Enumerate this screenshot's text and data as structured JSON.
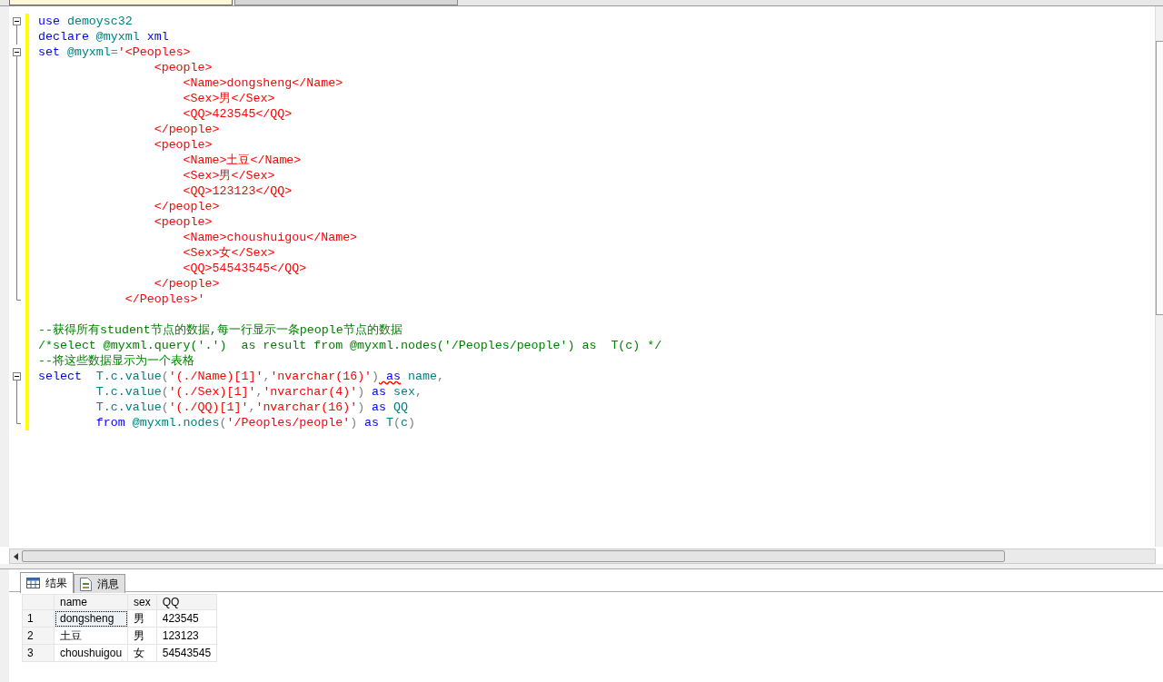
{
  "editor_tabs": [
    {
      "selected": true
    },
    {
      "selected": false
    }
  ],
  "code_lines": [
    {
      "kind": "start",
      "tokens": [
        {
          "kind": "keyword",
          "text": "use"
        },
        {
          "kind": "ident",
          "text": " demoysc32"
        }
      ]
    },
    {
      "kind": "inner",
      "tokens": [
        {
          "kind": "keyword",
          "text": "declare"
        },
        {
          "kind": "ident",
          "text": " @myxml"
        },
        {
          "kind": "keyword",
          "text": " xml"
        }
      ]
    },
    {
      "kind": "start",
      "tokens": [
        {
          "kind": "keyword",
          "text": "set"
        },
        {
          "kind": "ident",
          "text": " @myxml"
        },
        {
          "kind": "punct",
          "text": "="
        },
        {
          "kind": "string",
          "text": "'<Peoples>"
        }
      ]
    },
    {
      "kind": "inner",
      "tokens": [
        {
          "kind": "string",
          "text": "                <people>"
        }
      ]
    },
    {
      "kind": "inner",
      "tokens": [
        {
          "kind": "string",
          "text": "                    <Name>dongsheng</Name>"
        }
      ]
    },
    {
      "kind": "inner",
      "tokens": [
        {
          "kind": "string",
          "text": "                    <Sex>男</Sex>"
        }
      ]
    },
    {
      "kind": "inner",
      "tokens": [
        {
          "kind": "string",
          "text": "                    <QQ>423545</QQ>"
        }
      ]
    },
    {
      "kind": "inner",
      "tokens": [
        {
          "kind": "string",
          "text": "                </people>"
        }
      ]
    },
    {
      "kind": "inner",
      "tokens": [
        {
          "kind": "string",
          "text": "                <people>"
        }
      ]
    },
    {
      "kind": "inner",
      "tokens": [
        {
          "kind": "string",
          "text": "                    <Name>土豆</Name>"
        }
      ]
    },
    {
      "kind": "inner",
      "tokens": [
        {
          "kind": "string",
          "text": "                    <Sex>男</Sex>"
        }
      ]
    },
    {
      "kind": "inner",
      "tokens": [
        {
          "kind": "string",
          "text": "                    <QQ>123123</QQ>"
        }
      ]
    },
    {
      "kind": "inner",
      "tokens": [
        {
          "kind": "string",
          "text": "                </people>"
        }
      ]
    },
    {
      "kind": "inner",
      "tokens": [
        {
          "kind": "string",
          "text": "                <people>"
        }
      ]
    },
    {
      "kind": "inner",
      "tokens": [
        {
          "kind": "string",
          "text": "                    <Name>choushuigou</Name>"
        }
      ]
    },
    {
      "kind": "inner",
      "tokens": [
        {
          "kind": "string",
          "text": "                    <Sex>女</Sex>"
        }
      ]
    },
    {
      "kind": "inner",
      "tokens": [
        {
          "kind": "string",
          "text": "                    <QQ>54543545</QQ>"
        }
      ]
    },
    {
      "kind": "inner",
      "tokens": [
        {
          "kind": "string",
          "text": "                </people>"
        }
      ]
    },
    {
      "kind": "end",
      "tokens": [
        {
          "kind": "string",
          "text": "            </Peoples>'"
        }
      ]
    },
    {
      "kind": "blank"
    },
    {
      "kind": "plain",
      "tokens": [
        {
          "kind": "comment",
          "text": "--获得所有student节点的数据,每一行显示一条people节点的数据"
        }
      ]
    },
    {
      "kind": "plain",
      "tokens": [
        {
          "kind": "comment",
          "text": "/*select @myxml.query('.')  as result from @myxml.nodes('/Peoples/people') as  T(c) */"
        }
      ]
    },
    {
      "kind": "plain",
      "tokens": [
        {
          "kind": "comment",
          "text": "--将这些数据显示为一个表格"
        }
      ]
    },
    {
      "kind": "start",
      "tokens": [
        {
          "kind": "keyword",
          "text": "select"
        },
        {
          "kind": "ident",
          "text": "  T.c.value"
        },
        {
          "kind": "punct",
          "text": "("
        },
        {
          "kind": "string",
          "text": "'(./Name)[1]'"
        },
        {
          "kind": "punct",
          "text": ","
        },
        {
          "kind": "string",
          "text": "'nvarchar(16)'"
        },
        {
          "kind": "punct",
          "text": ")"
        },
        {
          "kind": "keyword_squiggle",
          "text": " as"
        },
        {
          "kind": "ident",
          "text": " name"
        },
        {
          "kind": "punct",
          "text": ","
        }
      ]
    },
    {
      "kind": "inner",
      "tokens": [
        {
          "kind": "ident",
          "text": "        T.c.value"
        },
        {
          "kind": "punct",
          "text": "("
        },
        {
          "kind": "string",
          "text": "'(./Sex)[1]'"
        },
        {
          "kind": "punct",
          "text": ","
        },
        {
          "kind": "string",
          "text": "'nvarchar(4)'"
        },
        {
          "kind": "punct",
          "text": ")"
        },
        {
          "kind": "keyword",
          "text": " as"
        },
        {
          "kind": "ident",
          "text": " sex"
        },
        {
          "kind": "punct",
          "text": ","
        }
      ]
    },
    {
      "kind": "inner",
      "tokens": [
        {
          "kind": "ident",
          "text": "        T.c.value"
        },
        {
          "kind": "punct",
          "text": "("
        },
        {
          "kind": "string",
          "text": "'(./QQ)[1]'"
        },
        {
          "kind": "punct",
          "text": ","
        },
        {
          "kind": "string",
          "text": "'nvarchar(16)'"
        },
        {
          "kind": "punct",
          "text": ")"
        },
        {
          "kind": "keyword",
          "text": " as"
        },
        {
          "kind": "ident",
          "text": " QQ"
        }
      ]
    },
    {
      "kind": "end",
      "tokens": [
        {
          "kind": "keyword",
          "text": "        from"
        },
        {
          "kind": "ident",
          "text": " @myxml.nodes"
        },
        {
          "kind": "punct",
          "text": "("
        },
        {
          "kind": "string",
          "text": "'/Peoples/people'"
        },
        {
          "kind": "punct",
          "text": ")"
        },
        {
          "kind": "keyword",
          "text": " as"
        },
        {
          "kind": "ident",
          "text": " T"
        },
        {
          "kind": "punct",
          "text": "("
        },
        {
          "kind": "ident",
          "text": "c"
        },
        {
          "kind": "punct",
          "text": ")"
        }
      ]
    }
  ],
  "result_tabs": [
    {
      "label": "结果",
      "selected": true,
      "kind": "grid"
    },
    {
      "label": "消息",
      "selected": false,
      "kind": "messages"
    }
  ],
  "results": {
    "columns": [
      "name",
      "sex",
      "QQ"
    ],
    "rows": [
      {
        "number": "1",
        "cells": [
          "dongsheng",
          "男",
          "423545"
        ],
        "focused": true
      },
      {
        "number": "2",
        "cells": [
          "土豆",
          "男",
          "123123"
        ],
        "focused": false
      },
      {
        "number": "3",
        "cells": [
          "choushuigou",
          "女",
          "54543545"
        ],
        "focused": false
      }
    ]
  }
}
